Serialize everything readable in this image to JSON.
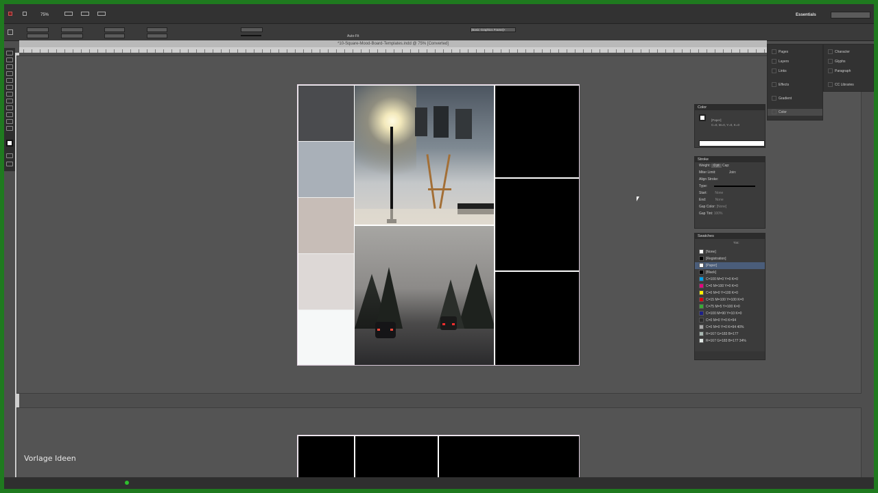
{
  "app": {
    "workspace": "Essentials",
    "zoom": "75%",
    "document_tab": "*10-Square-Mood-Board-Templates.indd @ 75% [Converted]",
    "control_font": "[Basic Graphics Frame]+",
    "auto_fit": "Auto-Fit"
  },
  "right_dock": {
    "col1": [
      "Pages",
      "Layers",
      "Links",
      "Effects",
      "Gradient",
      "Color"
    ],
    "col2": [
      "Character",
      "Glyphs",
      "Paragraph",
      "CC Libraries"
    ]
  },
  "color_panel": {
    "title": "Color",
    "swatch_name": "[Paper]",
    "values": "C=0, M=0, Y=0, K=0"
  },
  "stroke_panel": {
    "title": "Stroke",
    "weight_label": "Weight:",
    "weight_value": "0 pt",
    "cap_label": "Cap:",
    "miter_label": "Miter Limit:",
    "join_label": "Join:",
    "align_label": "Align Stroke:",
    "type_label": "Type:",
    "start_label": "Start:",
    "start_value": "None",
    "end_label": "End:",
    "end_value": "None",
    "gap_color_label": "Gap Color:",
    "gap_color_value": "[None]",
    "gap_tint_label": "Gap Tint:",
    "gap_tint_value": "100%"
  },
  "swatches_panel": {
    "title": "Swatches",
    "tint_label": "Tint:",
    "items": [
      {
        "name": "[None]",
        "color": "#ffffff"
      },
      {
        "name": "[Registration]",
        "color": "#000000"
      },
      {
        "name": "[Paper]",
        "color": "#ffffff"
      },
      {
        "name": "[Black]",
        "color": "#000000"
      },
      {
        "name": "C=100 M=0 Y=0 K=0",
        "color": "#00a0e9"
      },
      {
        "name": "C=0 M=100 Y=0 K=0",
        "color": "#e4007f"
      },
      {
        "name": "C=0 M=0 Y=100 K=0",
        "color": "#fff100"
      },
      {
        "name": "C=15 M=100 Y=100 K=0",
        "color": "#d7000f"
      },
      {
        "name": "C=75 M=5 Y=100 K=0",
        "color": "#3aa935"
      },
      {
        "name": "C=100 M=90 Y=10 K=0",
        "color": "#1d2088"
      },
      {
        "name": "C=0 M=0 Y=0 K=94",
        "color": "#2b2b2b"
      },
      {
        "name": "C=0 M=0 Y=0 K=94 40%",
        "color": "#a9a9a9"
      },
      {
        "name": "R=167 G=183 B=177",
        "color": "#a7b7b1"
      },
      {
        "name": "R=167 G=183 B=177 34%",
        "color": "#dfe6e3"
      }
    ]
  },
  "moodboard": {
    "palette": [
      "#4a4b4e",
      "#a9b0b8",
      "#c7bdb7",
      "#ddd8d6",
      "#f6f8f8"
    ]
  },
  "watermark": "Vorlage Ideen"
}
